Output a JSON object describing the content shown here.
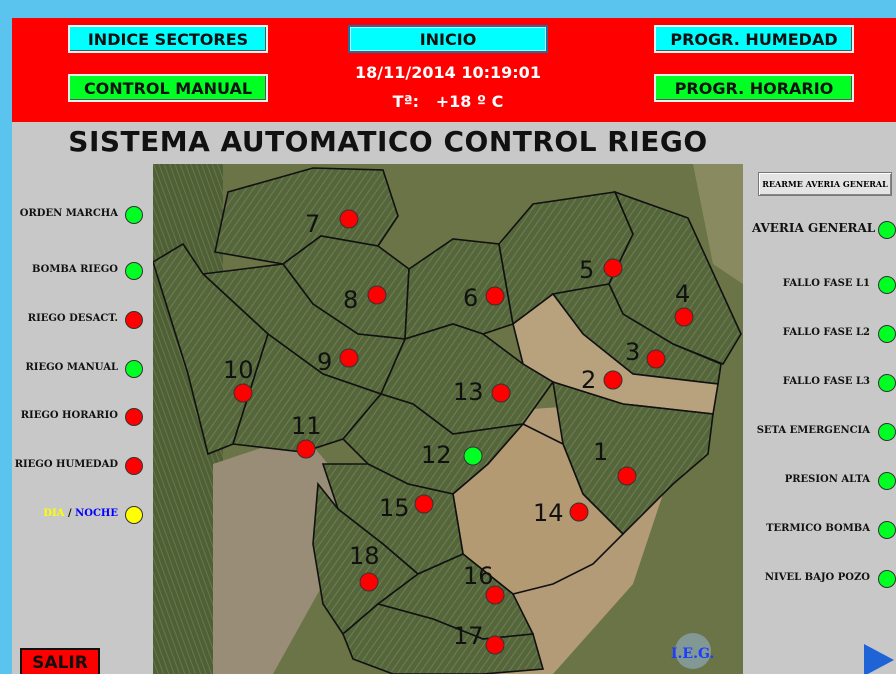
{
  "header": {
    "btn_indice": "INDICE SECTORES",
    "btn_control": "CONTROL MANUAL",
    "btn_inicio": "INICIO",
    "datetime": "18/11/2014 10:19:01",
    "temp_label": "Tª:",
    "temp_value": "+18 º C",
    "btn_humedad": "PROGR. HUMEDAD",
    "btn_horario": "PROGR. HORARIO"
  },
  "title": "SISTEMA AUTOMATICO CONTROL RIEGO",
  "left_status": [
    {
      "label": "ORDEN MARCHA",
      "state": "green"
    },
    {
      "label": "BOMBA RIEGO",
      "state": "green"
    },
    {
      "label": "RIEGO DESACT.",
      "state": "red"
    },
    {
      "label": "RIEGO MANUAL",
      "state": "green"
    },
    {
      "label": "RIEGO HORARIO",
      "state": "red"
    },
    {
      "label": "RIEGO HUMEDAD",
      "state": "red"
    }
  ],
  "dia_noche": {
    "dia": "DIA",
    "sep": " / ",
    "noche": "NOCHE",
    "state": "yellow"
  },
  "right_panel": {
    "rearme_button": "REARME AVERIA GENERAL",
    "averia_general": {
      "label": "AVERIA GENERAL",
      "state": "green"
    },
    "items": [
      {
        "label": "FALLO FASE L1",
        "state": "green"
      },
      {
        "label": "FALLO FASE L2",
        "state": "green"
      },
      {
        "label": "FALLO FASE L3",
        "state": "green"
      },
      {
        "label": "SETA EMERGENCIA",
        "state": "green"
      },
      {
        "label": "PRESION ALTA",
        "state": "green"
      },
      {
        "label": "TERMICO BOMBA",
        "state": "green"
      },
      {
        "label": "NIVEL BAJO POZO",
        "state": "green"
      }
    ]
  },
  "sectors": [
    {
      "num": "1",
      "state": "red"
    },
    {
      "num": "2",
      "state": "red"
    },
    {
      "num": "3",
      "state": "red"
    },
    {
      "num": "4",
      "state": "red"
    },
    {
      "num": "5",
      "state": "red"
    },
    {
      "num": "6",
      "state": "red"
    },
    {
      "num": "7",
      "state": "red"
    },
    {
      "num": "8",
      "state": "red"
    },
    {
      "num": "9",
      "state": "red"
    },
    {
      "num": "10",
      "state": "red"
    },
    {
      "num": "11",
      "state": "red"
    },
    {
      "num": "12",
      "state": "green"
    },
    {
      "num": "13",
      "state": "red"
    },
    {
      "num": "14",
      "state": "red"
    },
    {
      "num": "15",
      "state": "red"
    },
    {
      "num": "16",
      "state": "red"
    },
    {
      "num": "17",
      "state": "red"
    },
    {
      "num": "18",
      "state": "red"
    }
  ],
  "logo_text": "I.E.G.",
  "salir_button": "SALIR",
  "colors": {
    "header_red": "#ff0000",
    "btn_cyan": "#00ffff",
    "btn_green": "#00ff22",
    "led_green": "#00ff22",
    "led_red": "#ff0000",
    "led_yellow": "#ffff00",
    "dia_yellow": "#ffff00",
    "noche_blue": "#0000ff"
  },
  "icons": {
    "next": "triangle-right-icon"
  }
}
